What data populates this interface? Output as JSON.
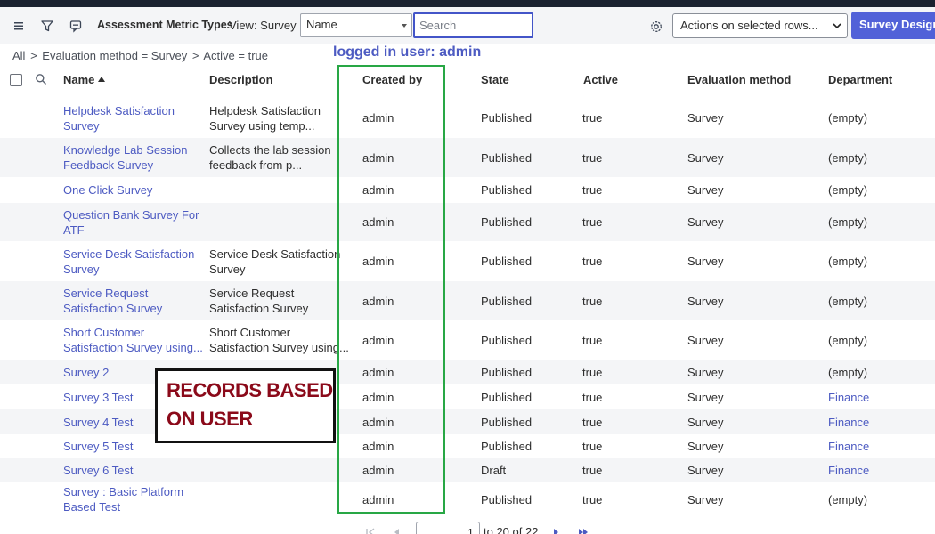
{
  "toolbar": {
    "title": "Assessment Metric Types",
    "view_label": "View: Survey",
    "field_select_value": "Name",
    "search_placeholder": "Search",
    "actions_select_value": "Actions on selected rows...",
    "primary_button": "Survey Designer"
  },
  "breadcrumb": {
    "items": [
      "All",
      ">",
      "Evaluation method = Survey",
      ">",
      "Active = true"
    ]
  },
  "annotations": {
    "logged_in_user": "logged in user: admin",
    "records_line1": "RECORDS BASED",
    "records_line2": "ON USER",
    "highlight_color": "#28a745",
    "annotation_text_color": "#8b0a1a"
  },
  "columns": {
    "name": "Name",
    "description": "Description",
    "created_by": "Created by",
    "state": "State",
    "active": "Active",
    "evaluation_method": "Evaluation method",
    "department": "Department"
  },
  "rows": [
    {
      "name_l1": "Helpdesk Satisfaction",
      "name_l2": "Survey",
      "desc_l1": "Helpdesk Satisfaction",
      "desc_l2": "Survey using temp...",
      "created_by": "admin",
      "state": "Published",
      "active": "true",
      "method": "Survey",
      "department": "(empty)",
      "dept_link": false
    },
    {
      "name_l1": "Knowledge Lab Session",
      "name_l2": "Feedback Survey",
      "desc_l1": "Collects the lab session",
      "desc_l2": "feedback from p...",
      "created_by": "admin",
      "state": "Published",
      "active": "true",
      "method": "Survey",
      "department": "(empty)",
      "dept_link": false
    },
    {
      "name_l1": "One Click Survey",
      "name_l2": "",
      "desc_l1": "",
      "desc_l2": "",
      "created_by": "admin",
      "state": "Published",
      "active": "true",
      "method": "Survey",
      "department": "(empty)",
      "dept_link": false
    },
    {
      "name_l1": "Question Bank Survey For",
      "name_l2": "ATF",
      "desc_l1": "",
      "desc_l2": "",
      "created_by": "admin",
      "state": "Published",
      "active": "true",
      "method": "Survey",
      "department": "(empty)",
      "dept_link": false
    },
    {
      "name_l1": "Service Desk Satisfaction",
      "name_l2": "Survey",
      "desc_l1": "Service Desk Satisfaction",
      "desc_l2": "Survey",
      "created_by": "admin",
      "state": "Published",
      "active": "true",
      "method": "Survey",
      "department": "(empty)",
      "dept_link": false
    },
    {
      "name_l1": "Service Request",
      "name_l2": "Satisfaction Survey",
      "desc_l1": "Service Request",
      "desc_l2": "Satisfaction Survey",
      "created_by": "admin",
      "state": "Published",
      "active": "true",
      "method": "Survey",
      "department": "(empty)",
      "dept_link": false
    },
    {
      "name_l1": "Short Customer",
      "name_l2": "Satisfaction Survey using...",
      "desc_l1": "Short Customer",
      "desc_l2": "Satisfaction Survey using...",
      "created_by": "admin",
      "state": "Published",
      "active": "true",
      "method": "Survey",
      "department": "(empty)",
      "dept_link": false
    },
    {
      "name_l1": "Survey 2",
      "name_l2": "",
      "desc_l1": "",
      "desc_l2": "",
      "created_by": "admin",
      "state": "Published",
      "active": "true",
      "method": "Survey",
      "department": "(empty)",
      "dept_link": false
    },
    {
      "name_l1": "Survey 3 Test",
      "name_l2": "",
      "desc_l1": "",
      "desc_l2": "",
      "created_by": "admin",
      "state": "Published",
      "active": "true",
      "method": "Survey",
      "department": "Finance",
      "dept_link": true
    },
    {
      "name_l1": "Survey 4 Test",
      "name_l2": "",
      "desc_l1": "",
      "desc_l2": "",
      "created_by": "admin",
      "state": "Published",
      "active": "true",
      "method": "Survey",
      "department": "Finance",
      "dept_link": true
    },
    {
      "name_l1": "Survey 5 Test",
      "name_l2": "",
      "desc_l1": "",
      "desc_l2": "",
      "created_by": "admin",
      "state": "Published",
      "active": "true",
      "method": "Survey",
      "department": "Finance",
      "dept_link": true
    },
    {
      "name_l1": "Survey 6 Test",
      "name_l2": "",
      "desc_l1": "",
      "desc_l2": "",
      "created_by": "admin",
      "state": "Draft",
      "active": "true",
      "method": "Survey",
      "department": "Finance",
      "dept_link": true
    },
    {
      "name_l1": "Survey : Basic Platform",
      "name_l2": "Based Test",
      "desc_l1": "",
      "desc_l2": "",
      "created_by": "admin",
      "state": "Published",
      "active": "true",
      "method": "Survey",
      "department": "(empty)",
      "dept_link": false
    }
  ],
  "pagination": {
    "current_page": "1",
    "range_text": "to 20 of 22"
  }
}
